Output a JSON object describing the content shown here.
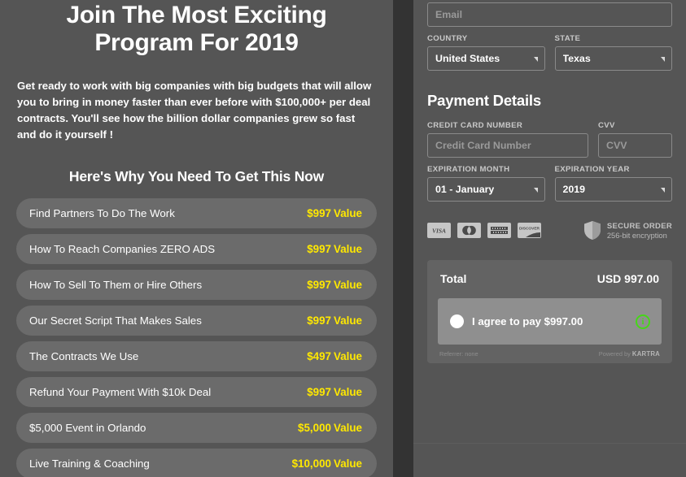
{
  "left": {
    "headline": "Join The Most Exciting Program For 2019",
    "subtext": "Get ready to work with big companies with big budgets that will allow you to bring in money faster than ever before with $100,000+ per deal contracts. You'll see how the billion dollar companies grew so fast and do it yourself !",
    "section_title": "Here's Why You Need To Get This Now",
    "value_word": "Value",
    "benefits": [
      {
        "label": "Find Partners To Do The Work",
        "value": "$997"
      },
      {
        "label": "How To Reach Companies ZERO ADS",
        "value": "$997"
      },
      {
        "label": "How To Sell To Them or Hire Others",
        "value": "$997"
      },
      {
        "label": "Our Secret Script That Makes Sales",
        "value": "$997"
      },
      {
        "label": "The Contracts We Use",
        "value": "$497"
      },
      {
        "label": "Refund Your Payment With $10k Deal",
        "value": "$997"
      },
      {
        "label": "$5,000 Event in Orlando",
        "value": "$5,000"
      },
      {
        "label": "Live Training & Coaching",
        "value": "$10,000"
      }
    ]
  },
  "form": {
    "email_placeholder": "Email",
    "country_label": "COUNTRY",
    "country_value": "United States",
    "state_label": "STATE",
    "state_value": "Texas",
    "payment_title": "Payment Details",
    "card_number_label": "CREDIT CARD NUMBER",
    "card_number_placeholder": "Credit Card Number",
    "cvv_label": "CVV",
    "cvv_placeholder": "CVV",
    "exp_month_label": "EXPIRATION MONTH",
    "exp_month_value": "01 - January",
    "exp_year_label": "EXPIRATION YEAR",
    "exp_year_value": "2019"
  },
  "trust": {
    "cards": [
      "VISA",
      "MASTERCARD",
      "AMERICAN EXPRESS",
      "DISCOVER"
    ],
    "secure_title": "SECURE ORDER",
    "secure_subtitle": "256-bit encryption"
  },
  "total": {
    "label": "Total",
    "amount": "USD 997.00",
    "agree_text": "I agree to pay $997.00",
    "referrer": "Referrer: none",
    "powered_prefix": "Powered by ",
    "powered_brand": "KARTRA"
  },
  "colors": {
    "panel_bg": "#555555",
    "divider": "#333333",
    "row_bg": "#6b6b6b",
    "accent_yellow": "#ffe800",
    "info_green": "#46d718",
    "total_bg": "#636363",
    "agree_bg": "#8f8f8f"
  }
}
